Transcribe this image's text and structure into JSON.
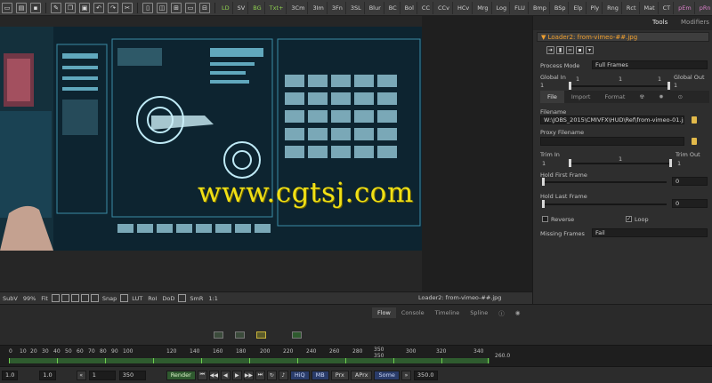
{
  "toolbar": {
    "buttons": [
      "LD",
      "SV",
      "BG",
      "Txt+",
      "3Cm",
      "3Im",
      "3Fn",
      "3SL",
      "Blur",
      "BC",
      "Bol",
      "CC",
      "CCv",
      "HCv",
      "Mrg",
      "Log",
      "FLU",
      "Bmp",
      "BSp",
      "Elp",
      "Ply",
      "Rng",
      "Rct",
      "Mat",
      "CT",
      "pEm",
      "pRn"
    ]
  },
  "watermark": "www.cgtsj.com",
  "viewer_bar": {
    "items": [
      "SubV",
      "99%",
      "Fit",
      "Snap",
      "LUT",
      "RoI",
      "DoD",
      "SmR",
      "1:1"
    ],
    "status": "Loader2: from-vimeo-##.jpg"
  },
  "inspector": {
    "tabs": [
      "Tools",
      "Modifiers"
    ],
    "node_title": "Loader2: from-vimeo-##.jpg",
    "process_mode": {
      "label": "Process Mode",
      "value": "Full Frames"
    },
    "global_in": {
      "label": "Global In",
      "value": "1"
    },
    "global_out": {
      "label": "Global Out",
      "value": "1"
    },
    "ruler_values": [
      "1",
      "1",
      "1"
    ],
    "param_tabs": [
      "File",
      "Import",
      "Format"
    ],
    "filename": {
      "label": "Filename",
      "value": "W:\\JOBS_2015\\CMIVFX\\HUD\\Ref\\from-vimeo-01.jpg"
    },
    "proxy_filename": {
      "label": "Proxy Filename",
      "value": ""
    },
    "trim_in": {
      "label": "Trim In",
      "value": "1"
    },
    "trim_out": {
      "label": "Trim Out",
      "value": "1"
    },
    "trim_mid": "1",
    "hold_first": {
      "label": "Hold First Frame",
      "value": "0"
    },
    "hold_last": {
      "label": "Hold Last Frame",
      "value": "0"
    },
    "reverse": {
      "label": "Reverse",
      "checked": false
    },
    "loop": {
      "label": "Loop",
      "checked": true
    },
    "missing_frames": {
      "label": "Missing Frames",
      "value": "Fail"
    }
  },
  "flow": {
    "tabs": [
      "Flow",
      "Console",
      "Timeline",
      "Spline"
    ]
  },
  "ruler": {
    "ticks": [
      "0",
      "10",
      "20",
      "30",
      "40",
      "50",
      "60",
      "70",
      "80",
      "90",
      "100",
      "120",
      "140",
      "160",
      "180",
      "200",
      "220",
      "240",
      "260",
      "280",
      "300",
      "320",
      "340"
    ],
    "markers": [
      "350",
      "350"
    ],
    "end_value": "260.0"
  },
  "transport": {
    "start": "1.0",
    "current": "1.0",
    "range_start": "1",
    "range_end": "350",
    "render": "Render",
    "hiq": "HiQ",
    "mb": "MB",
    "prx": "Prx",
    "aprx": "APrx",
    "some": "Some",
    "end": "350.0"
  },
  "colors": {
    "accent_orange": "#f0a030",
    "watermark_yellow": "#f0e016",
    "timeline_green": "#6fcf4f"
  }
}
